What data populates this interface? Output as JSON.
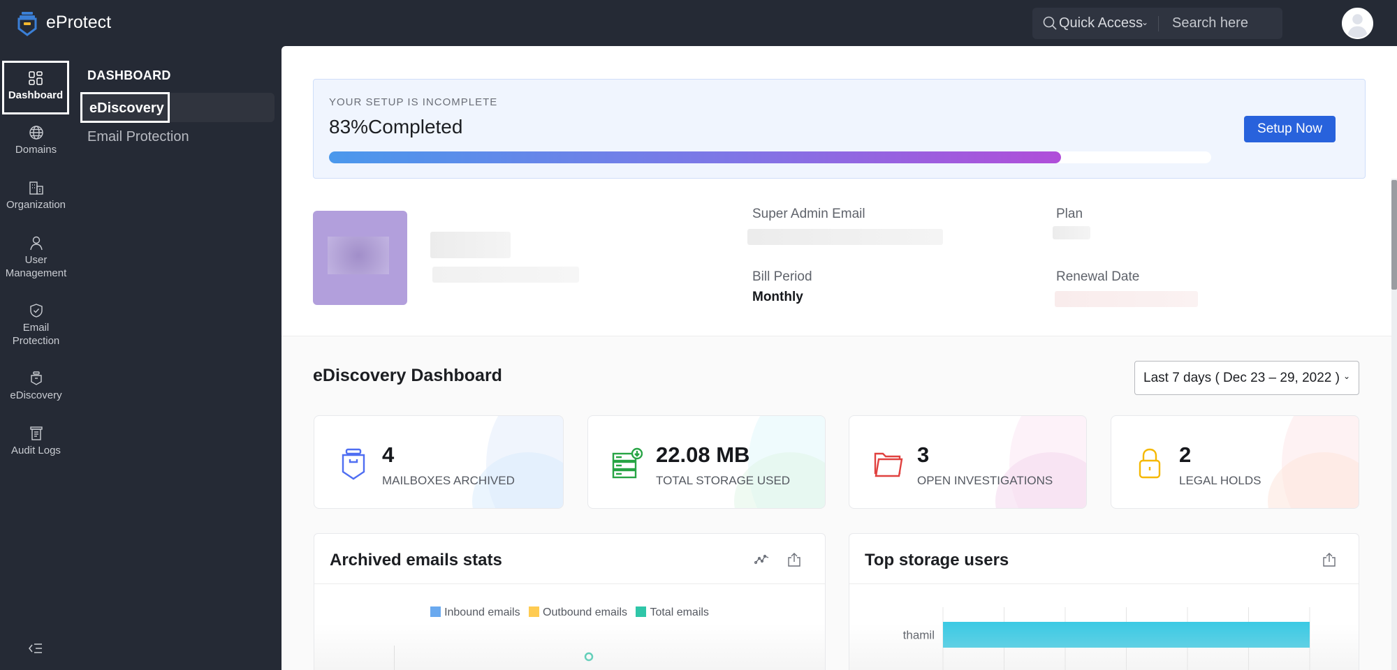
{
  "app": {
    "title": "eProtect",
    "logo_icon": "eprotect-shield-logo"
  },
  "topbar": {
    "quick_access_label": "Quick Access",
    "search_placeholder": "Search here",
    "avatar_icon": "user-avatar"
  },
  "rail": {
    "items": [
      {
        "label": "Dashboard",
        "icon": "dashboard-grid-icon",
        "active": true
      },
      {
        "label": "Domains",
        "icon": "globe-icon"
      },
      {
        "label": "Organization",
        "icon": "building-icon"
      },
      {
        "label": "User Management",
        "icon": "user-icon"
      },
      {
        "label": "Email Protection",
        "icon": "shield-check-icon"
      },
      {
        "label": "eDiscovery",
        "icon": "archive-box-icon"
      },
      {
        "label": "Audit Logs",
        "icon": "document-log-icon"
      }
    ],
    "collapse_icon": "collapse-menu-icon"
  },
  "subnav": {
    "heading": "DASHBOARD",
    "items": [
      {
        "label": "eDiscovery",
        "active": true
      },
      {
        "label": "Email Protection"
      }
    ]
  },
  "setup": {
    "kicker": "YOUR SETUP IS INCOMPLETE",
    "percent_text": "83%Completed",
    "progress_percent": 83,
    "button_label": "Setup Now"
  },
  "profile": {
    "super_admin_email_label": "Super Admin Email",
    "plan_label": "Plan",
    "bill_period_label": "Bill Period",
    "bill_period_value": "Monthly",
    "renewal_date_label": "Renewal Date"
  },
  "dashboard": {
    "title": "eDiscovery Dashboard",
    "date_range": "Last 7 days ( Dec 23 – 29, 2022 )",
    "stats": [
      {
        "value": "4",
        "label": "MAILBOXES ARCHIVED",
        "icon": "mailbox-archive-icon",
        "color": "#4f6ef2"
      },
      {
        "value": "22.08 MB",
        "label": "TOTAL STORAGE USED",
        "icon": "server-storage-icon",
        "color": "#27a444"
      },
      {
        "value": "3",
        "label": "OPEN INVESTIGATIONS",
        "icon": "folder-icon",
        "color": "#e0413f"
      },
      {
        "value": "2",
        "label": "LEGAL HOLDS",
        "icon": "lock-icon",
        "color": "#f5b800"
      }
    ]
  },
  "archived_stats": {
    "title": "Archived emails stats",
    "legend": [
      {
        "label": "Inbound emails",
        "color": "#6aa9ef"
      },
      {
        "label": "Outbound emails",
        "color": "#fecb52"
      },
      {
        "label": "Total emails",
        "color": "#2fc6a8"
      }
    ]
  },
  "top_storage": {
    "title": "Top storage users",
    "bar_color": "#3ccae4"
  },
  "chart_data": [
    {
      "type": "line",
      "title": "Archived emails stats",
      "legend": [
        "Inbound emails",
        "Outbound emails",
        "Total emails"
      ],
      "legend_placement": "top-center",
      "series": [
        {
          "name": "Total emails",
          "points_visible": 1
        }
      ]
    },
    {
      "type": "bar",
      "orientation": "horizontal",
      "title": "Top storage users",
      "categories": [
        "thamil"
      ],
      "values": [
        1.0
      ],
      "value_note": "single user; bar spans full visible scale",
      "grid": true
    }
  ]
}
